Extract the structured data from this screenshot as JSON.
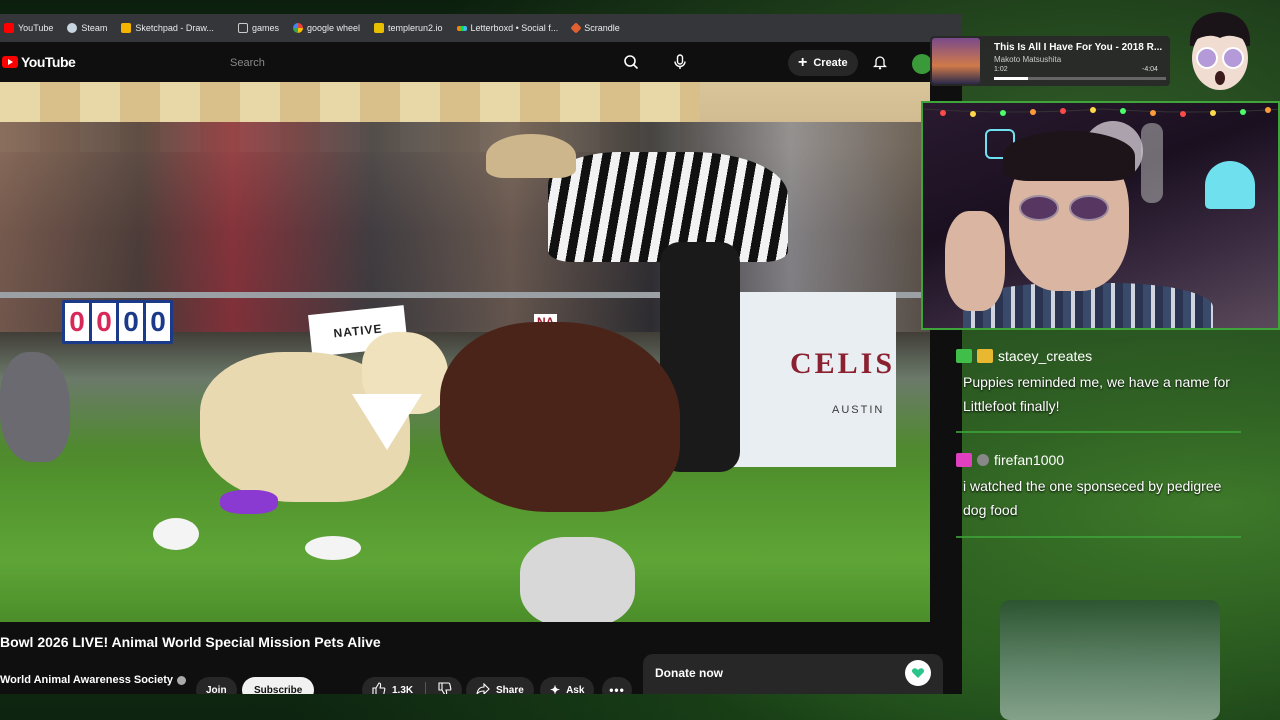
{
  "bookmarks": [
    {
      "label": "YouTube",
      "color": "#ff0000"
    },
    {
      "label": "Steam",
      "color": "#1b2838"
    },
    {
      "label": "Sketchpad - Draw...",
      "color": "#f4b400"
    },
    {
      "label": "games",
      "color": "#cccccc"
    },
    {
      "label": "google wheel",
      "color": "#4285f4"
    },
    {
      "label": "templerun2.io",
      "color": "#e8c000"
    },
    {
      "label": "Letterboxd • Social f...",
      "color": "#40bcf4"
    },
    {
      "label": "Scrandle",
      "color": "#e06030"
    }
  ],
  "youtube": {
    "logo_text": "YouTube",
    "search_placeholder": "Search",
    "create_label": "Create"
  },
  "video": {
    "scoreboard": [
      "0",
      "0",
      "0",
      "0"
    ],
    "banner_brand": "CELIS",
    "banner_sub": "AUSTIN",
    "flag_text": "NATIVE",
    "banner_small": "NA",
    "title": "Bowl 2026 LIVE! Animal World Special Mission Pets Alive",
    "channel": "World Animal Awareness Society",
    "join_label": "Join",
    "subscribe_label": "Subscribe",
    "likes": "1.3K",
    "share_label": "Share",
    "ask_label": "Ask"
  },
  "donate": {
    "title": "Donate now"
  },
  "music": {
    "title": "This Is All I Have For You - 2018 R...",
    "artist": "Makoto Matsushita",
    "elapsed": "1:02",
    "remaining": "-4:04",
    "progress_fraction": 0.2
  },
  "chat": [
    {
      "username": "stacey_creates",
      "message": "Puppies reminded me, we have a name for Littlefoot finally!",
      "badge_color": "#3fbf4a",
      "badge2_color": "#e8b830"
    },
    {
      "username": "firefan1000",
      "message": "i watched the one sponseced by pedigree dog food",
      "badge_color": "#e040c0",
      "badge2_color": "#888888"
    }
  ],
  "colors": {
    "accent_green": "#3fa43a",
    "youtube_red": "#ff0000"
  }
}
